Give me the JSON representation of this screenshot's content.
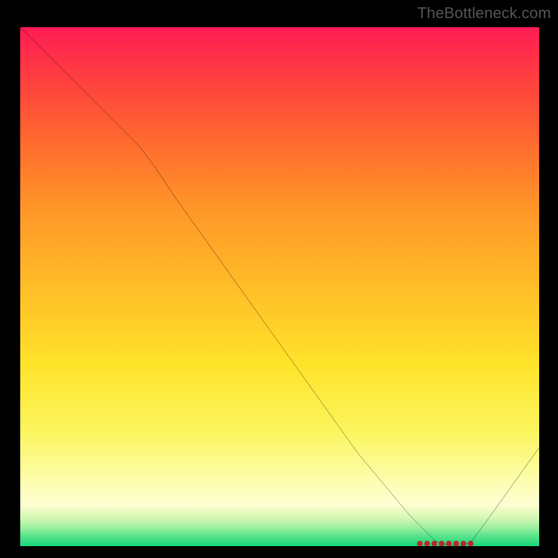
{
  "watermark": "TheBottleneck.com",
  "marker_text": "",
  "chart_data": {
    "type": "line",
    "title": "",
    "xlabel": "",
    "ylabel": "",
    "xlim": [
      0,
      100
    ],
    "ylim": [
      0,
      100
    ],
    "gradient_colors_top_to_bottom": [
      "#ff1b55",
      "#ff3f3f",
      "#ff6a2e",
      "#ff9628",
      "#ffbd27",
      "#ffe32a",
      "#f7f45a",
      "#fdfeb3",
      "#d6f7a4",
      "#73e891",
      "#16d77d"
    ],
    "optimal_band_y_range": [
      0,
      3.5
    ],
    "series": [
      {
        "name": "curve",
        "x": [
          0,
          4,
          8,
          12,
          16,
          20,
          23,
          26,
          30,
          35,
          40,
          45,
          50,
          55,
          60,
          65,
          70,
          75,
          80,
          83,
          85,
          87,
          90,
          95,
          100
        ],
        "y": [
          100,
          96,
          92,
          88,
          84,
          80,
          77,
          73,
          67,
          60,
          53,
          46,
          39,
          32,
          25,
          18,
          12,
          6,
          1,
          0,
          0,
          1,
          5,
          12,
          19
        ]
      }
    ],
    "marker": {
      "x": 82,
      "y": 0.5
    }
  }
}
